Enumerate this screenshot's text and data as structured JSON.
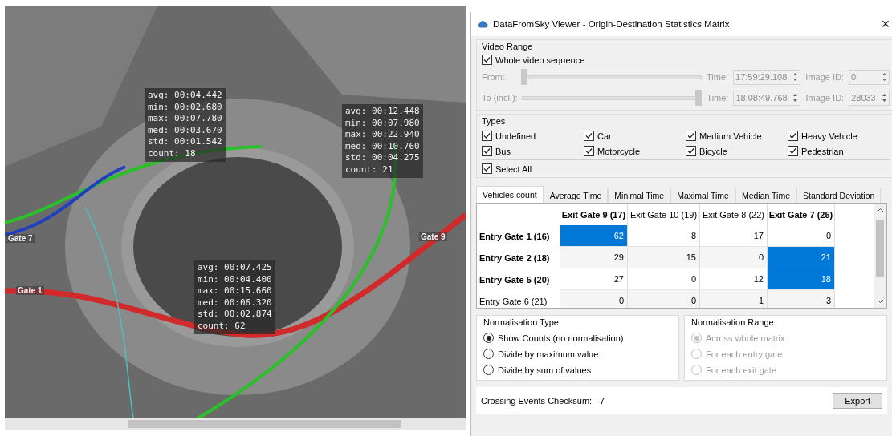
{
  "video": {
    "overlays": [
      {
        "lines": [
          "avg: 00:04.442",
          "min: 00:02.680",
          "max: 00:07.780",
          "med: 00:03.670",
          "std: 00:01.542",
          "count: 18"
        ]
      },
      {
        "lines": [
          "avg: 00:12.448",
          "min: 00:07.980",
          "max: 00:22.940",
          "med: 00:10.760",
          "std: 00:04.275",
          "count: 21"
        ]
      },
      {
        "lines": [
          "avg: 00:07.425",
          "min: 00:04.400",
          "max: 00:15.660",
          "med: 00:06.320",
          "std: 00:02.874",
          "count: 62"
        ]
      }
    ],
    "gates": [
      "Gate 7",
      "Gate 9",
      "Gate 1"
    ]
  },
  "window": {
    "title": "DataFromSky Viewer - Origin-Destination Statistics Matrix",
    "close": "×"
  },
  "video_range": {
    "title": "Video Range",
    "whole_sequence": {
      "label": "Whole video sequence",
      "checked": true
    },
    "sliders": [
      {
        "label": "From:",
        "level": 0,
        "time_label": "Time:",
        "time": "17:59:29.108",
        "image_label": "Image ID:",
        "image_id": "0"
      },
      {
        "label": "To (incl.):",
        "level": 1,
        "time_label": "Time:",
        "time": "18:08:49.768",
        "image_label": "Image ID:",
        "image_id": "28033"
      }
    ]
  },
  "types": {
    "title": "Types",
    "items": [
      {
        "label": "Undefined",
        "checked": true
      },
      {
        "label": "Car",
        "checked": true
      },
      {
        "label": "Medium Vehicle",
        "checked": true
      },
      {
        "label": "Heavy Vehicle",
        "checked": true
      },
      {
        "label": "Bus",
        "checked": true
      },
      {
        "label": "Motorcycle",
        "checked": true
      },
      {
        "label": "Bicycle",
        "checked": true
      },
      {
        "label": "Pedestrian",
        "checked": true
      }
    ],
    "select_all": {
      "label": "Select All",
      "checked": true
    }
  },
  "tabs": [
    {
      "label": "Vehicles count",
      "selected": true
    },
    {
      "label": "Average Time",
      "selected": false
    },
    {
      "label": "Minimal Time",
      "selected": false
    },
    {
      "label": "Maximal Time",
      "selected": false
    },
    {
      "label": "Median Time",
      "selected": false
    },
    {
      "label": "Standard Deviation",
      "selected": false
    }
  ],
  "matrix": {
    "columns": [
      {
        "label": "Exit Gate 9 (17)",
        "bold": true
      },
      {
        "label": "Exit Gate 10 (19)",
        "bold": false
      },
      {
        "label": "Exit Gate 8 (22)",
        "bold": false
      },
      {
        "label": "Exit Gate 7 (25)",
        "bold": true
      }
    ],
    "rows": [
      {
        "label": "Entry Gate 1 (16)",
        "bold": true,
        "cells": [
          {
            "value": "62",
            "selected": true
          },
          {
            "value": "8",
            "selected": false
          },
          {
            "value": "17",
            "selected": false
          },
          {
            "value": "0",
            "selected": false
          }
        ]
      },
      {
        "label": "Entry Gate 2 (18)",
        "bold": true,
        "cells": [
          {
            "value": "29",
            "selected": false
          },
          {
            "value": "15",
            "selected": false
          },
          {
            "value": "0",
            "selected": false
          },
          {
            "value": "21",
            "selected": true
          }
        ]
      },
      {
        "label": "Entry Gate 5 (20)",
        "bold": true,
        "cells": [
          {
            "value": "27",
            "selected": false
          },
          {
            "value": "0",
            "selected": false
          },
          {
            "value": "12",
            "selected": false
          },
          {
            "value": "18",
            "selected": true
          }
        ]
      },
      {
        "label": "Entry Gate 6 (21)",
        "bold": false,
        "cells": [
          {
            "value": "0",
            "selected": false
          },
          {
            "value": "0",
            "selected": false
          },
          {
            "value": "1",
            "selected": false
          },
          {
            "value": "3",
            "selected": false
          }
        ]
      }
    ]
  },
  "normalisation_type": {
    "title": "Normalisation Type",
    "disabled": false,
    "options": [
      {
        "label": "Show Counts (no normalisation)",
        "selected": true
      },
      {
        "label": "Divide by maximum value",
        "selected": false
      },
      {
        "label": "Divide by sum of values",
        "selected": false
      }
    ]
  },
  "normalisation_range": {
    "title": "Normalisation Range",
    "disabled": true,
    "options": [
      {
        "label": "Across whole matrix",
        "selected": true
      },
      {
        "label": "For each entry gate",
        "selected": false
      },
      {
        "label": "For each exit gate",
        "selected": false
      }
    ]
  },
  "checksum": "Crossing Events Checksum:  -7",
  "export_button": "Export"
}
